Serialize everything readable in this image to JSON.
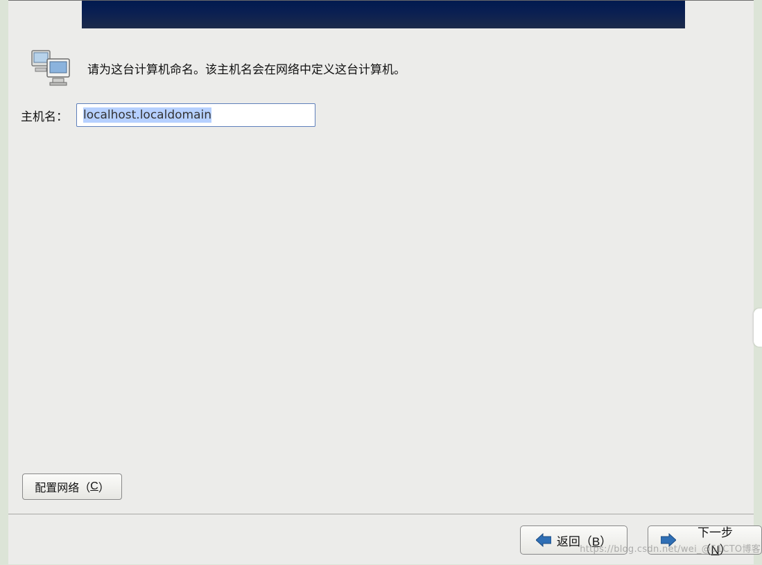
{
  "description": "请为这台计算机命名。该主机名会在网络中定义这台计算机。",
  "hostname": {
    "label": "主机名：",
    "value": "localhost.localdomain"
  },
  "buttons": {
    "configure_network_prefix": "配置网络（",
    "configure_network_key": "C",
    "configure_network_suffix": "）",
    "back_prefix": "返回（",
    "back_key": "B",
    "back_suffix": "）",
    "next_prefix": "下一步（",
    "next_key": "N",
    "next_suffix": "）"
  },
  "watermark": "https://blog.csdn.net/wei_@51CTO博客"
}
